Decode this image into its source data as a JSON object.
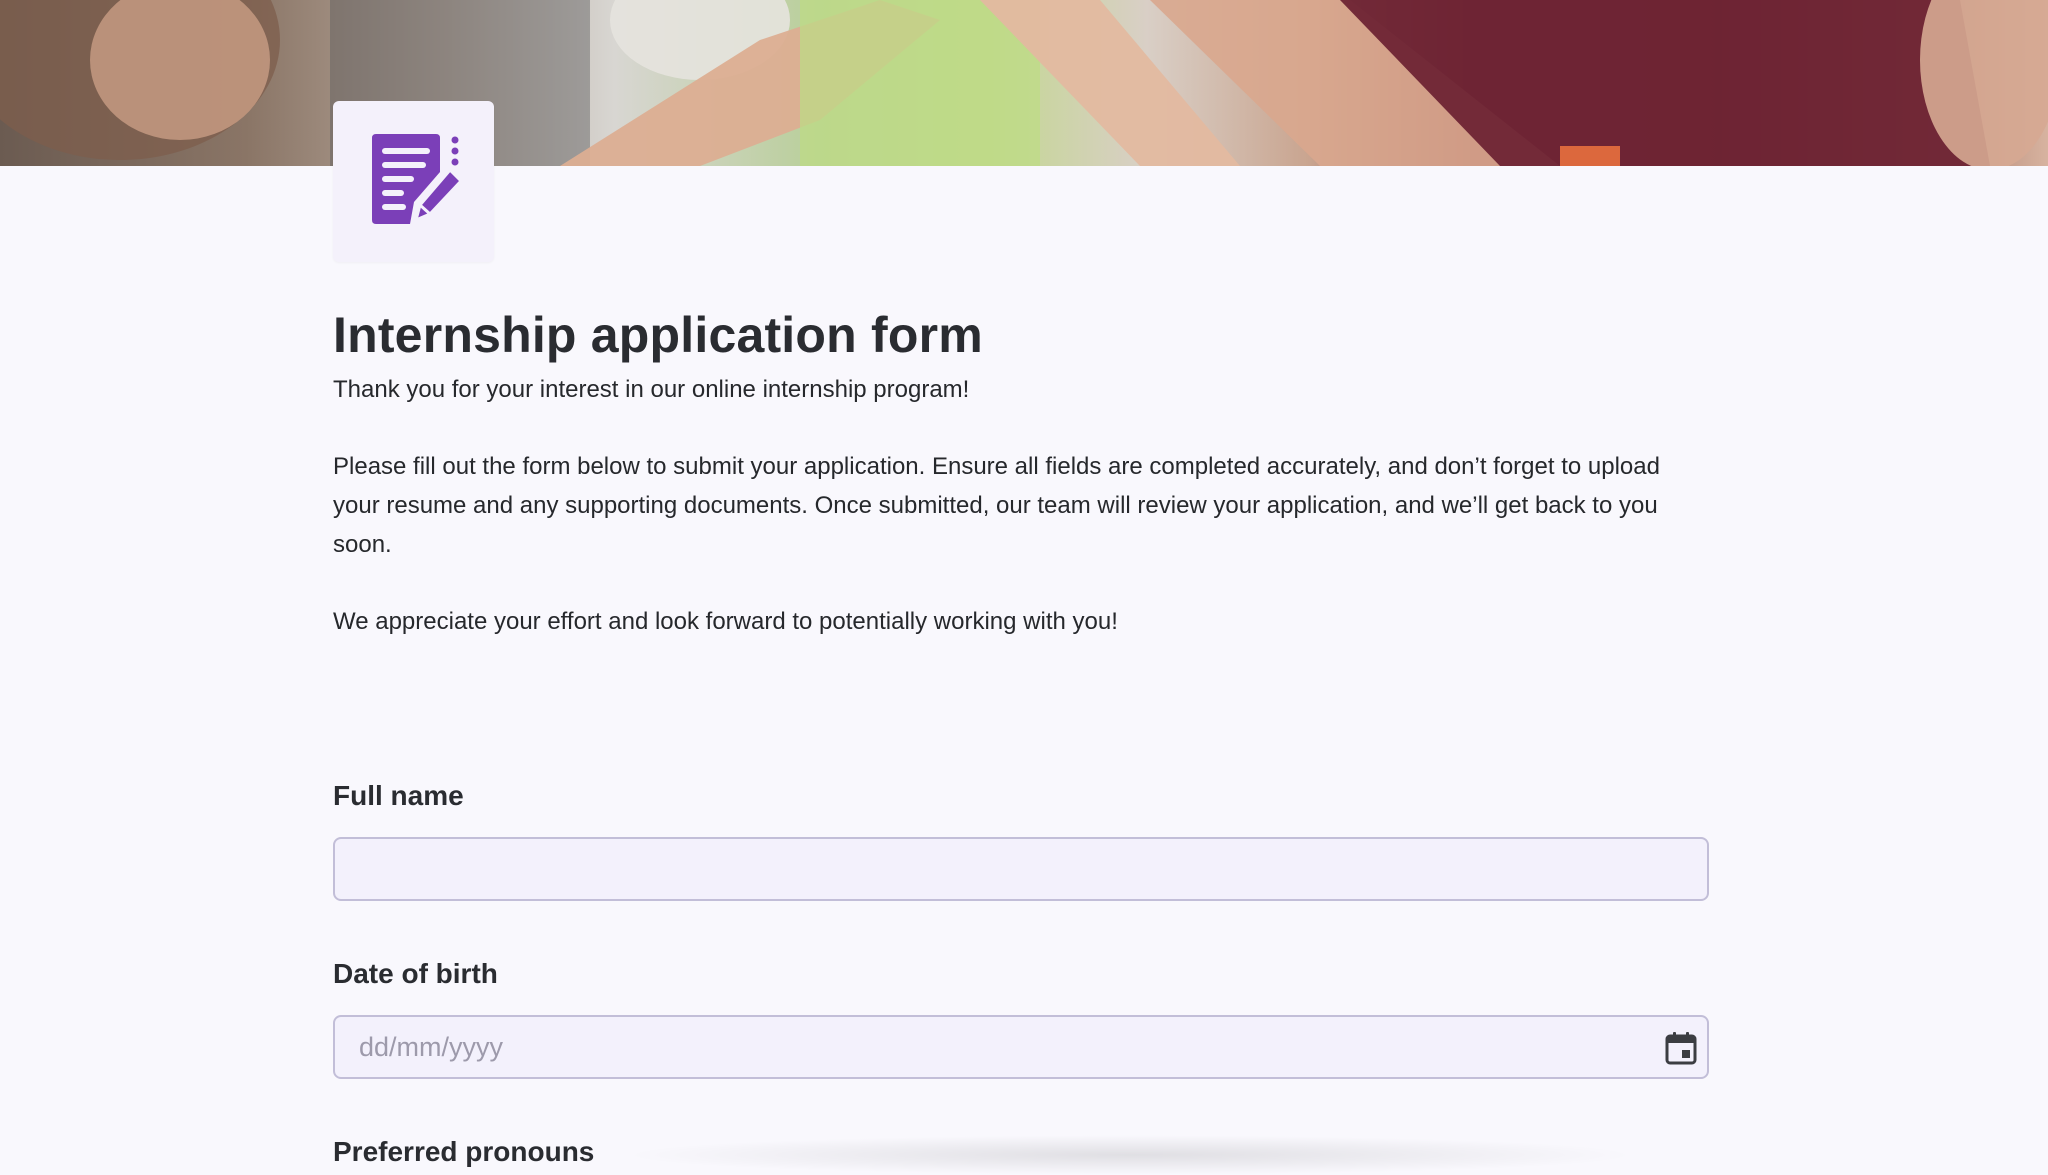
{
  "header": {
    "banner_image": "team-hands-together-photo",
    "logo_icon": "document-edit-icon",
    "accent_color": "#7b3fb8"
  },
  "form": {
    "title": "Internship application form",
    "description": {
      "p1": "Thank you for your interest in our online internship program!",
      "p2": "Please fill out the form below to submit your application. Ensure all fields are completed accurately, and don’t forget to upload your resume and any supporting documents. Once submitted, our team will review your application, and we’ll get back to you soon.",
      "p3": "We appreciate your effort and look forward to potentially working with you!"
    },
    "fields": {
      "full_name": {
        "label": "Full name",
        "value": "",
        "placeholder": ""
      },
      "date_of_birth": {
        "label": "Date of birth",
        "value": "",
        "placeholder": "dd/mm/yyyy",
        "icon": "calendar-icon"
      },
      "preferred_pronouns": {
        "label": "Preferred pronouns"
      }
    }
  }
}
